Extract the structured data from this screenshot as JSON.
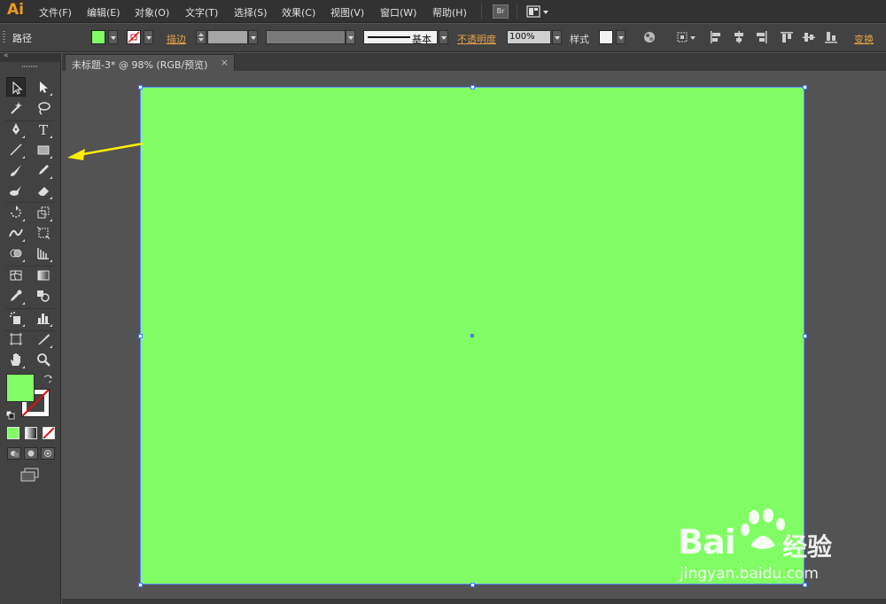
{
  "app": {
    "logo": "Ai"
  },
  "menu": {
    "items": [
      "文件(F)",
      "编辑(E)",
      "对象(O)",
      "文字(T)",
      "选择(S)",
      "效果(C)",
      "视图(V)",
      "窗口(W)",
      "帮助(H)"
    ],
    "bridge_label": "Br"
  },
  "controlbar": {
    "selection_type": "路径",
    "stroke_label": "描边",
    "stroke_profile": "基本",
    "opacity_label": "不透明度",
    "opacity_value": "100%",
    "style_label": "样式",
    "transform_label": "变换"
  },
  "document": {
    "tab_title": "未标题-3* @ 98% (RGB/预览)",
    "close": "×"
  },
  "colors": {
    "fill": "#80fd64",
    "selection": "#4a78ff",
    "annotation_arrow": "#ffee00"
  },
  "watermark": {
    "logo": "Bai",
    "logo_suffix": "经验",
    "url": "jingyan.baidu.com"
  }
}
